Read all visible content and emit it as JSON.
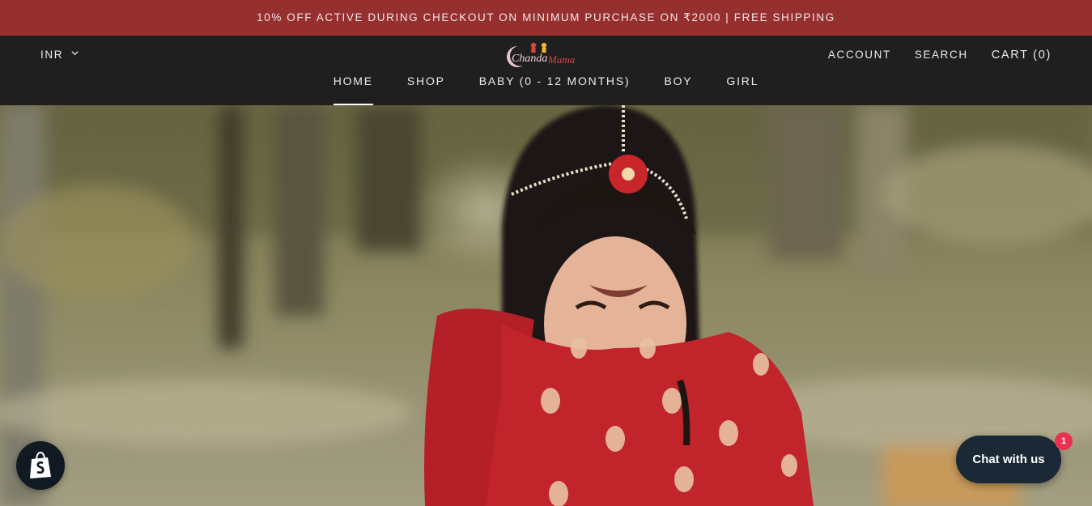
{
  "announcement": {
    "text": "10% OFF ACTIVE DURING CHECKOUT ON MINIMUM PURCHASE ON ₹2000 | FREE SHIPPING"
  },
  "header": {
    "currency": "INR",
    "logo_text_1": "Chanda",
    "logo_text_2": "Mama",
    "account_label": "ACCOUNT",
    "search_label": "SEARCH",
    "cart_label": "CART (0)"
  },
  "nav": {
    "items": [
      {
        "label": "HOME",
        "active": true
      },
      {
        "label": "SHOP",
        "active": false
      },
      {
        "label": "BABY (0 - 12 MONTHS)",
        "active": false
      },
      {
        "label": "BOY",
        "active": false
      },
      {
        "label": "GIRL",
        "active": false
      }
    ]
  },
  "chat": {
    "label": "Chat with us",
    "badge_count": "1"
  },
  "colors": {
    "announcement_bg": "#96302f",
    "header_bg": "#1f1f1f",
    "chat_bg": "#1a2935",
    "chat_badge": "#e8324f"
  },
  "icons": {
    "currency_chevron": "chevron-down-icon",
    "shopify": "shopify-bag-icon"
  }
}
